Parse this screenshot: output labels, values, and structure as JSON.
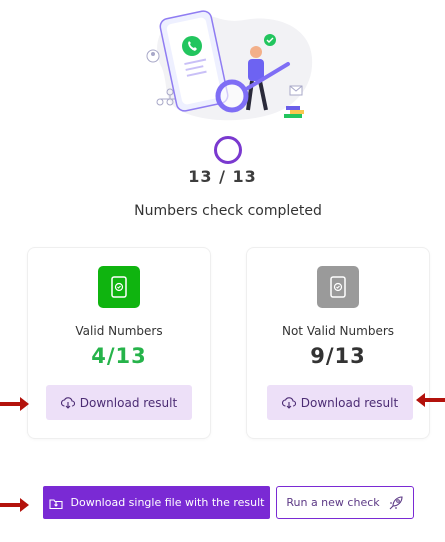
{
  "progress": {
    "count_text": "13 / 13",
    "status_text": "Numbers check completed"
  },
  "valid_card": {
    "label": "Valid Numbers",
    "count": "4/13",
    "button_label": "Download result",
    "color": "#0fb40f"
  },
  "invalid_card": {
    "label": "Not Valid Numbers",
    "count": "9/13",
    "button_label": "Download result",
    "color": "#9a9a9a"
  },
  "actions": {
    "single_file_label": "Download single file with the result",
    "new_check_label": "Run a new check"
  },
  "colors": {
    "accent": "#7a2ad4",
    "accent_light": "#ede0f8",
    "valid_text": "#26b34a",
    "arrow": "#b3120c"
  },
  "icons": {
    "hero": "whatsapp-search-illustration",
    "valid": "phone-check-icon",
    "invalid": "phone-check-icon",
    "download": "cloud-download-icon",
    "single_file": "file-download-icon",
    "new_check": "rocket-icon"
  }
}
